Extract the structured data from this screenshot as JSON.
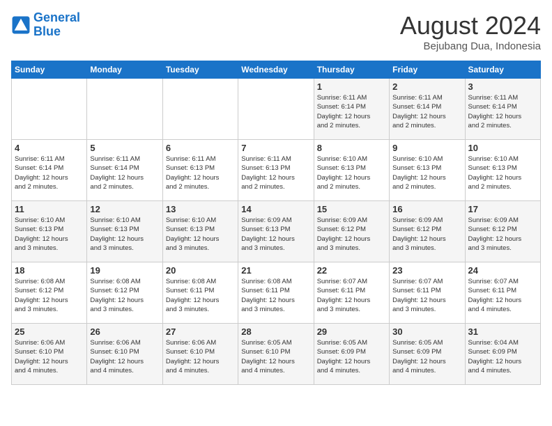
{
  "logo": {
    "line1": "General",
    "line2": "Blue"
  },
  "title": "August 2024",
  "subtitle": "Bejubang Dua, Indonesia",
  "days_of_week": [
    "Sunday",
    "Monday",
    "Tuesday",
    "Wednesday",
    "Thursday",
    "Friday",
    "Saturday"
  ],
  "weeks": [
    [
      {
        "day": "",
        "info": ""
      },
      {
        "day": "",
        "info": ""
      },
      {
        "day": "",
        "info": ""
      },
      {
        "day": "",
        "info": ""
      },
      {
        "day": "1",
        "info": "Sunrise: 6:11 AM\nSunset: 6:14 PM\nDaylight: 12 hours\nand 2 minutes."
      },
      {
        "day": "2",
        "info": "Sunrise: 6:11 AM\nSunset: 6:14 PM\nDaylight: 12 hours\nand 2 minutes."
      },
      {
        "day": "3",
        "info": "Sunrise: 6:11 AM\nSunset: 6:14 PM\nDaylight: 12 hours\nand 2 minutes."
      }
    ],
    [
      {
        "day": "4",
        "info": "Sunrise: 6:11 AM\nSunset: 6:14 PM\nDaylight: 12 hours\nand 2 minutes."
      },
      {
        "day": "5",
        "info": "Sunrise: 6:11 AM\nSunset: 6:14 PM\nDaylight: 12 hours\nand 2 minutes."
      },
      {
        "day": "6",
        "info": "Sunrise: 6:11 AM\nSunset: 6:13 PM\nDaylight: 12 hours\nand 2 minutes."
      },
      {
        "day": "7",
        "info": "Sunrise: 6:11 AM\nSunset: 6:13 PM\nDaylight: 12 hours\nand 2 minutes."
      },
      {
        "day": "8",
        "info": "Sunrise: 6:10 AM\nSunset: 6:13 PM\nDaylight: 12 hours\nand 2 minutes."
      },
      {
        "day": "9",
        "info": "Sunrise: 6:10 AM\nSunset: 6:13 PM\nDaylight: 12 hours\nand 2 minutes."
      },
      {
        "day": "10",
        "info": "Sunrise: 6:10 AM\nSunset: 6:13 PM\nDaylight: 12 hours\nand 2 minutes."
      }
    ],
    [
      {
        "day": "11",
        "info": "Sunrise: 6:10 AM\nSunset: 6:13 PM\nDaylight: 12 hours\nand 3 minutes."
      },
      {
        "day": "12",
        "info": "Sunrise: 6:10 AM\nSunset: 6:13 PM\nDaylight: 12 hours\nand 3 minutes."
      },
      {
        "day": "13",
        "info": "Sunrise: 6:10 AM\nSunset: 6:13 PM\nDaylight: 12 hours\nand 3 minutes."
      },
      {
        "day": "14",
        "info": "Sunrise: 6:09 AM\nSunset: 6:13 PM\nDaylight: 12 hours\nand 3 minutes."
      },
      {
        "day": "15",
        "info": "Sunrise: 6:09 AM\nSunset: 6:12 PM\nDaylight: 12 hours\nand 3 minutes."
      },
      {
        "day": "16",
        "info": "Sunrise: 6:09 AM\nSunset: 6:12 PM\nDaylight: 12 hours\nand 3 minutes."
      },
      {
        "day": "17",
        "info": "Sunrise: 6:09 AM\nSunset: 6:12 PM\nDaylight: 12 hours\nand 3 minutes."
      }
    ],
    [
      {
        "day": "18",
        "info": "Sunrise: 6:08 AM\nSunset: 6:12 PM\nDaylight: 12 hours\nand 3 minutes."
      },
      {
        "day": "19",
        "info": "Sunrise: 6:08 AM\nSunset: 6:12 PM\nDaylight: 12 hours\nand 3 minutes."
      },
      {
        "day": "20",
        "info": "Sunrise: 6:08 AM\nSunset: 6:11 PM\nDaylight: 12 hours\nand 3 minutes."
      },
      {
        "day": "21",
        "info": "Sunrise: 6:08 AM\nSunset: 6:11 PM\nDaylight: 12 hours\nand 3 minutes."
      },
      {
        "day": "22",
        "info": "Sunrise: 6:07 AM\nSunset: 6:11 PM\nDaylight: 12 hours\nand 3 minutes."
      },
      {
        "day": "23",
        "info": "Sunrise: 6:07 AM\nSunset: 6:11 PM\nDaylight: 12 hours\nand 3 minutes."
      },
      {
        "day": "24",
        "info": "Sunrise: 6:07 AM\nSunset: 6:11 PM\nDaylight: 12 hours\nand 4 minutes."
      }
    ],
    [
      {
        "day": "25",
        "info": "Sunrise: 6:06 AM\nSunset: 6:10 PM\nDaylight: 12 hours\nand 4 minutes."
      },
      {
        "day": "26",
        "info": "Sunrise: 6:06 AM\nSunset: 6:10 PM\nDaylight: 12 hours\nand 4 minutes."
      },
      {
        "day": "27",
        "info": "Sunrise: 6:06 AM\nSunset: 6:10 PM\nDaylight: 12 hours\nand 4 minutes."
      },
      {
        "day": "28",
        "info": "Sunrise: 6:05 AM\nSunset: 6:10 PM\nDaylight: 12 hours\nand 4 minutes."
      },
      {
        "day": "29",
        "info": "Sunrise: 6:05 AM\nSunset: 6:09 PM\nDaylight: 12 hours\nand 4 minutes."
      },
      {
        "day": "30",
        "info": "Sunrise: 6:05 AM\nSunset: 6:09 PM\nDaylight: 12 hours\nand 4 minutes."
      },
      {
        "day": "31",
        "info": "Sunrise: 6:04 AM\nSunset: 6:09 PM\nDaylight: 12 hours\nand 4 minutes."
      }
    ]
  ]
}
